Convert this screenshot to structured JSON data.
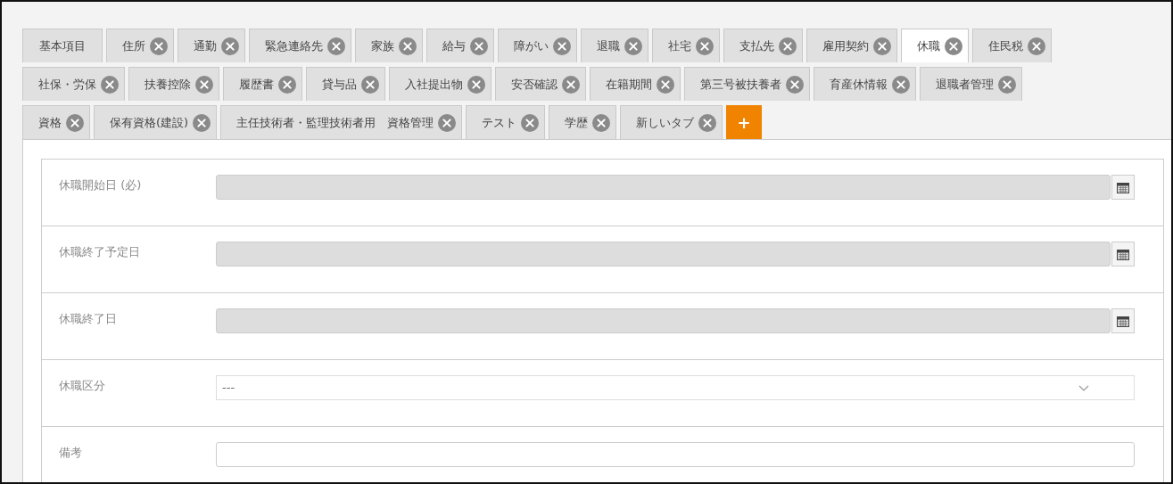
{
  "tab_rows": [
    [
      {
        "label": "基本項目",
        "closable": false,
        "selected": false
      },
      {
        "label": "住所",
        "closable": true,
        "selected": false
      },
      {
        "label": "通勤",
        "closable": true,
        "selected": false
      },
      {
        "label": "緊急連絡先",
        "closable": true,
        "selected": false
      },
      {
        "label": "家族",
        "closable": true,
        "selected": false
      },
      {
        "label": "給与",
        "closable": true,
        "selected": false
      },
      {
        "label": "障がい",
        "closable": true,
        "selected": false
      },
      {
        "label": "退職",
        "closable": true,
        "selected": false
      },
      {
        "label": "社宅",
        "closable": true,
        "selected": false
      },
      {
        "label": "支払先",
        "closable": true,
        "selected": false
      },
      {
        "label": "雇用契約",
        "closable": true,
        "selected": false
      },
      {
        "label": "休職",
        "closable": true,
        "selected": true
      },
      {
        "label": "住民税",
        "closable": true,
        "selected": false
      }
    ],
    [
      {
        "label": "社保・労保",
        "closable": true,
        "selected": false
      },
      {
        "label": "扶養控除",
        "closable": true,
        "selected": false
      },
      {
        "label": "履歴書",
        "closable": true,
        "selected": false
      },
      {
        "label": "貸与品",
        "closable": true,
        "selected": false
      },
      {
        "label": "入社提出物",
        "closable": true,
        "selected": false
      },
      {
        "label": "安否確認",
        "closable": true,
        "selected": false
      },
      {
        "label": "在籍期間",
        "closable": true,
        "selected": false
      },
      {
        "label": "第三号被扶養者",
        "closable": true,
        "selected": false
      },
      {
        "label": "育産休情報",
        "closable": true,
        "selected": false
      },
      {
        "label": "退職者管理",
        "closable": true,
        "selected": false
      }
    ],
    [
      {
        "label": "資格",
        "closable": true,
        "selected": false
      },
      {
        "label": "保有資格(建設)",
        "closable": true,
        "selected": false
      },
      {
        "label": "主任技術者・監理技術者用　資格管理",
        "closable": true,
        "selected": false
      },
      {
        "label": "テスト",
        "closable": true,
        "selected": false
      },
      {
        "label": "学歴",
        "closable": true,
        "selected": false
      },
      {
        "label": "新しいタブ",
        "closable": true,
        "selected": false
      }
    ]
  ],
  "add_tab": "+",
  "fields": [
    {
      "label": "休職開始日 (必)",
      "kind": "date",
      "disabled": true
    },
    {
      "label": "休職終了予定日",
      "kind": "date",
      "disabled": true
    },
    {
      "label": "休職終了日",
      "kind": "date",
      "disabled": true
    },
    {
      "label": "休職区分",
      "kind": "select",
      "disabled": false,
      "value": "---"
    },
    {
      "label": "備考",
      "kind": "text",
      "disabled": false
    }
  ]
}
